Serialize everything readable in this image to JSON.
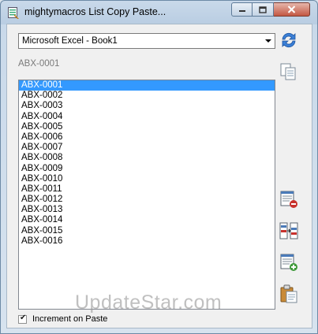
{
  "window": {
    "title": "mightymacros List Copy Paste..."
  },
  "combo": {
    "value": "Microsoft Excel - Book1"
  },
  "current_item": "ABX-0001",
  "list": {
    "items": [
      "ABX-0001",
      "ABX-0002",
      "ABX-0003",
      "ABX-0004",
      "ABX-0005",
      "ABX-0006",
      "ABX-0007",
      "ABX-0008",
      "ABX-0009",
      "ABX-0010",
      "ABX-0011",
      "ABX-0012",
      "ABX-0013",
      "ABX-0014",
      "ABX-0015",
      "ABX-0016"
    ],
    "selected_index": 0
  },
  "increment": {
    "label": "Increment on Paste",
    "checked": true
  },
  "watermark": "UpdateStar.com",
  "icons": {
    "app": "list-icon",
    "refresh": "refresh-icon",
    "copy": "copy-icon",
    "remove": "list-remove-icon",
    "transfer": "list-transfer-icon",
    "add": "list-add-icon",
    "paste": "paste-icon"
  },
  "colors": {
    "selection": "#3399ff",
    "titlebar": "#b9cde2",
    "close": "#c45843"
  }
}
